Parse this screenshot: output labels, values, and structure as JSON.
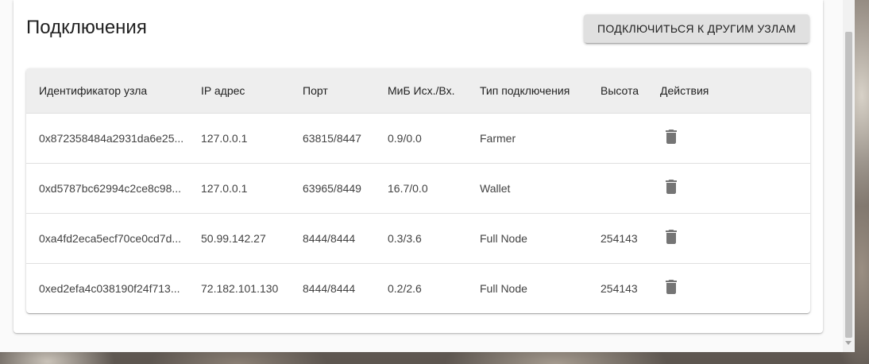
{
  "card": {
    "title": "Подключения",
    "connect_button": "ПОДКЛЮЧИТЬСЯ К ДРУГИМ УЗЛАМ"
  },
  "table": {
    "headers": [
      "Идентификатор узла",
      "IP адрес",
      "Порт",
      "МиБ Исх./Вх.",
      "Тип подключения",
      "Высота",
      "Действия"
    ],
    "rows": [
      {
        "node_id": "0x872358484a2931da6e25...",
        "ip": "127.0.0.1",
        "port": "63815/8447",
        "mib": "0.9/0.0",
        "type": "Farmer",
        "height": "",
        "action_icon": "trash-icon"
      },
      {
        "node_id": "0xd5787bc62994c2ce8c98...",
        "ip": "127.0.0.1",
        "port": "63965/8449",
        "mib": "16.7/0.0",
        "type": "Wallet",
        "height": "",
        "action_icon": "trash-icon"
      },
      {
        "node_id": "0xa4fd2eca5ecf70ce0cd7d...",
        "ip": "50.99.142.27",
        "port": "8444/8444",
        "mib": "0.3/3.6",
        "type": "Full Node",
        "height": "254143",
        "action_icon": "trash-icon"
      },
      {
        "node_id": "0xed2efa4c038190f24f713...",
        "ip": "72.182.101.130",
        "port": "8444/8444",
        "mib": "0.2/2.6",
        "type": "Full Node",
        "height": "254143",
        "action_icon": "trash-icon"
      }
    ]
  },
  "colors": {
    "header_bg": "#eeeeee",
    "button_bg": "#e0e0e0",
    "icon": "#757575"
  }
}
